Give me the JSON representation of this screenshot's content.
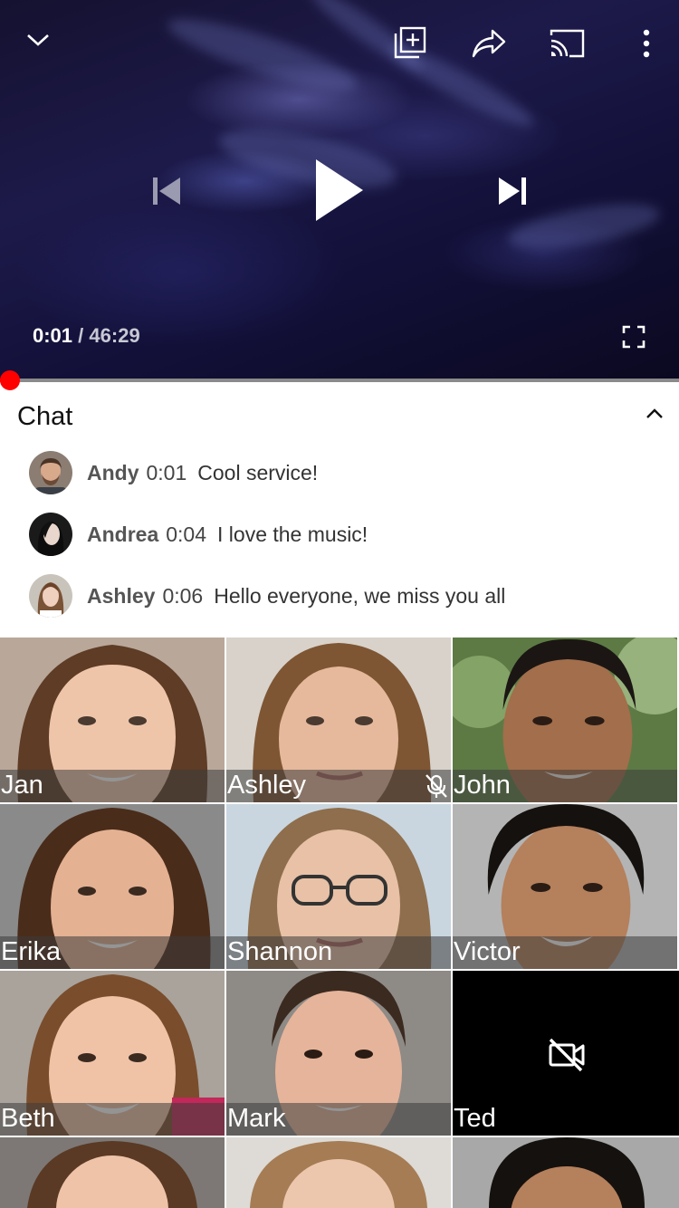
{
  "player": {
    "current_time": "0:01",
    "separator": "/",
    "duration": "46:29",
    "progress_fraction": 0.0004,
    "icons": {
      "collapse": "chevron-down-icon",
      "add_to_playlist": "add-to-playlist-icon",
      "share": "share-icon",
      "cast": "cast-icon",
      "more": "more-vert-icon",
      "previous": "skip-previous-icon",
      "play": "play-icon",
      "next": "skip-next-icon",
      "fullscreen": "fullscreen-icon"
    },
    "accent": "#ff0000"
  },
  "chat": {
    "title": "Chat",
    "toggle_icon": "chevron-up-icon",
    "messages": [
      {
        "author": "Andy",
        "time": "0:01",
        "text": "Cool service!"
      },
      {
        "author": "Andrea",
        "time": "0:04",
        "text": "I love the music!"
      },
      {
        "author": "Ashley",
        "time": "0:06",
        "text": "Hello everyone, we miss you all"
      }
    ]
  },
  "participants": [
    {
      "name": "Jan",
      "muted": false,
      "video": true
    },
    {
      "name": "Ashley",
      "muted": false,
      "video": true
    },
    {
      "name": "John",
      "muted": true,
      "video": true
    },
    {
      "name": "Erika",
      "muted": false,
      "video": true
    },
    {
      "name": "Shannon",
      "muted": false,
      "video": true
    },
    {
      "name": "Victor",
      "muted": false,
      "video": true
    },
    {
      "name": "Beth",
      "muted": false,
      "video": true
    },
    {
      "name": "Mark",
      "muted": false,
      "video": true
    },
    {
      "name": "Ted",
      "muted": false,
      "video": false
    }
  ]
}
